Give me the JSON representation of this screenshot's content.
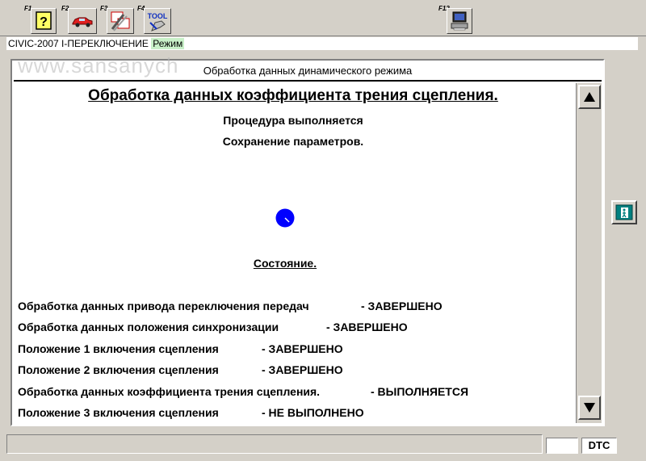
{
  "toolbar": {
    "f1_label": "F1",
    "f2_label": "F2",
    "f3_label": "F3",
    "f4_label": "F4",
    "f12_label": "F12",
    "f1_icon": "help-question-icon",
    "f2_icon": "vehicle-car-icon",
    "f3_icon": "mt-at-transmission-icon",
    "f4_icon": "tool-icon",
    "f4_text": "TOOL",
    "f12_icon": "computer-print-icon"
  },
  "info_bar": {
    "model": "CIVIC-2007 I-ПЕРЕКЛЮЧЕНИЕ",
    "mode": "Режим"
  },
  "watermark": "www.sansanych",
  "panel": {
    "header": "Обработка данных динамического режима",
    "title": "Обработка данных коэффициента трения сцепления.",
    "line1": "Процедура выполняется",
    "line2": "Сохранение параметров.",
    "status_heading": "Состояние."
  },
  "status_rows": [
    {
      "name": "Обработка данных привода переключения передач",
      "state": "-  ЗАВЕРШЕНО"
    },
    {
      "name": "Обработка данных положения синхронизации",
      "state": "-  ЗАВЕРШЕНО"
    },
    {
      "name": "Положение 1 включения сцепления",
      "state": "-  ЗАВЕРШЕНО"
    },
    {
      "name": "Положение 2 включения сцепления",
      "state": "-  ЗАВЕРШЕНО"
    },
    {
      "name": "Обработка данных коэффициента трения сцепления.",
      "state": "-  ВЫПОЛНЯЕТСЯ"
    },
    {
      "name": "Положение 3 включения сцепления",
      "state": "-  НЕ ВЫПОЛНЕНО"
    }
  ],
  "spinner_icon": "progress-clock-icon",
  "exit_icon": "exit-door-icon",
  "status_bar": {
    "dtc": "DTC"
  },
  "colors": {
    "window_bg": "#d4d0c8",
    "mode_highlight": "#c8f0c8",
    "spinner": "#0000ff"
  }
}
